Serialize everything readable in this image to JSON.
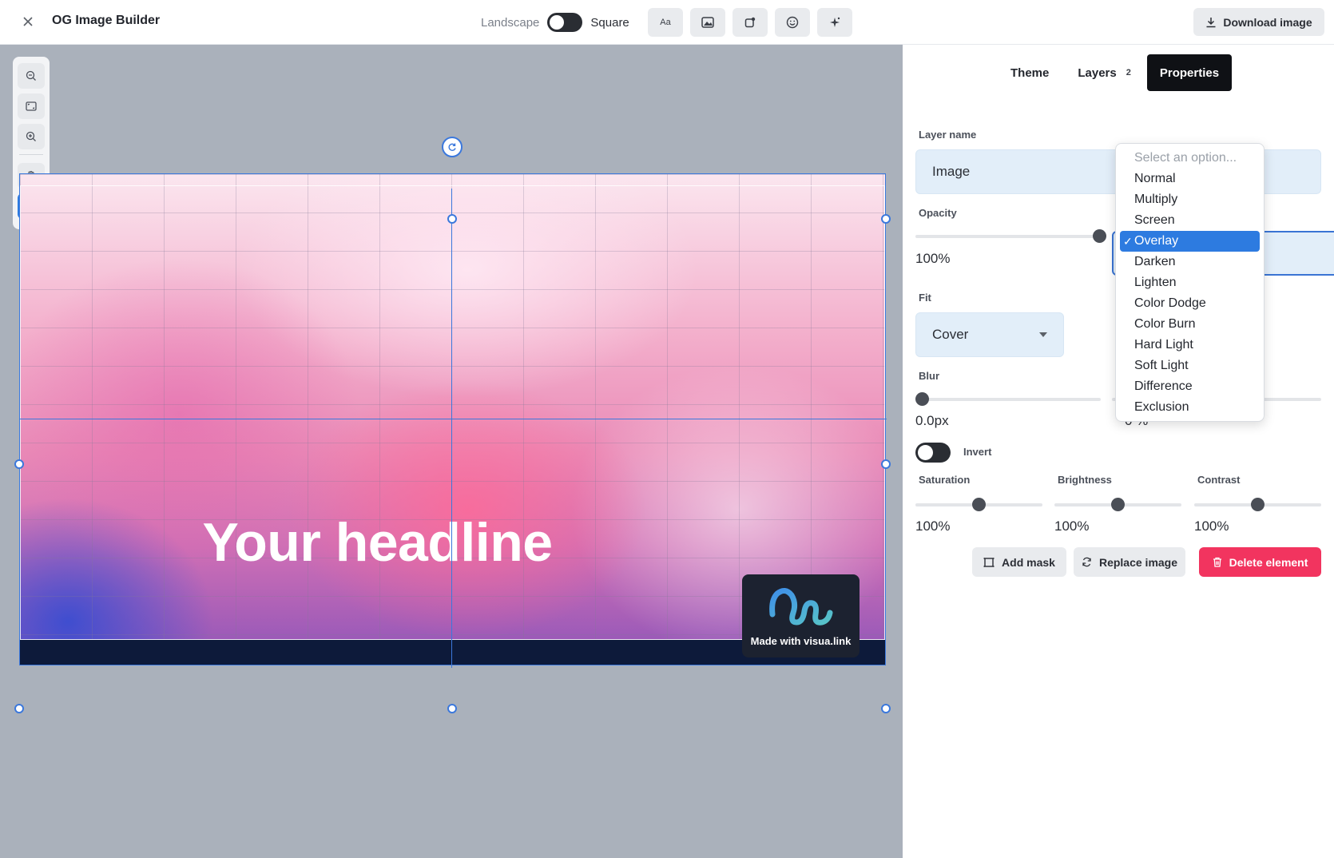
{
  "app": {
    "title": "OG Image Builder"
  },
  "orientation": {
    "left_label": "Landscape",
    "right_label": "Square"
  },
  "toolbar": {
    "text_tool_label": "Aa",
    "download_label": "Download image"
  },
  "canvas": {
    "headline": "Your headline",
    "badge_text": "Made with visua.link"
  },
  "tabs": [
    {
      "label": "Theme"
    },
    {
      "label": "Layers",
      "count": "2"
    },
    {
      "label": "Properties",
      "active": true
    }
  ],
  "properties": {
    "layer_name_label": "Layer name",
    "layer_name_value": "Image",
    "opacity_label": "Opacity",
    "opacity_value": "100%",
    "opacity_level": 1.0,
    "fit_label": "Fit",
    "fit_value": "Cover",
    "blur_label": "Blur",
    "blur_value": "0.0px",
    "blur_level": 0.0,
    "blend_partial_value": "0 %",
    "invert_label": "Invert",
    "invert_on": false,
    "saturation_label": "Saturation",
    "saturation_value": "100%",
    "brightness_label": "Brightness",
    "brightness_value": "100%",
    "contrast_label": "Contrast",
    "contrast_value": "100%",
    "add_mask_label": "Add mask",
    "replace_image_label": "Replace image",
    "delete_label": "Delete element"
  },
  "blend_dropdown": {
    "placeholder": "Select an option...",
    "options": [
      "Normal",
      "Multiply",
      "Screen",
      "Overlay",
      "Darken",
      "Lighten",
      "Color Dodge",
      "Color Burn",
      "Hard Light",
      "Soft Light",
      "Difference",
      "Exclusion"
    ],
    "selected": "Overlay"
  },
  "colors": {
    "accent": "#2d7be0",
    "selection": "#3b78dc",
    "delete": "#f2345f"
  }
}
